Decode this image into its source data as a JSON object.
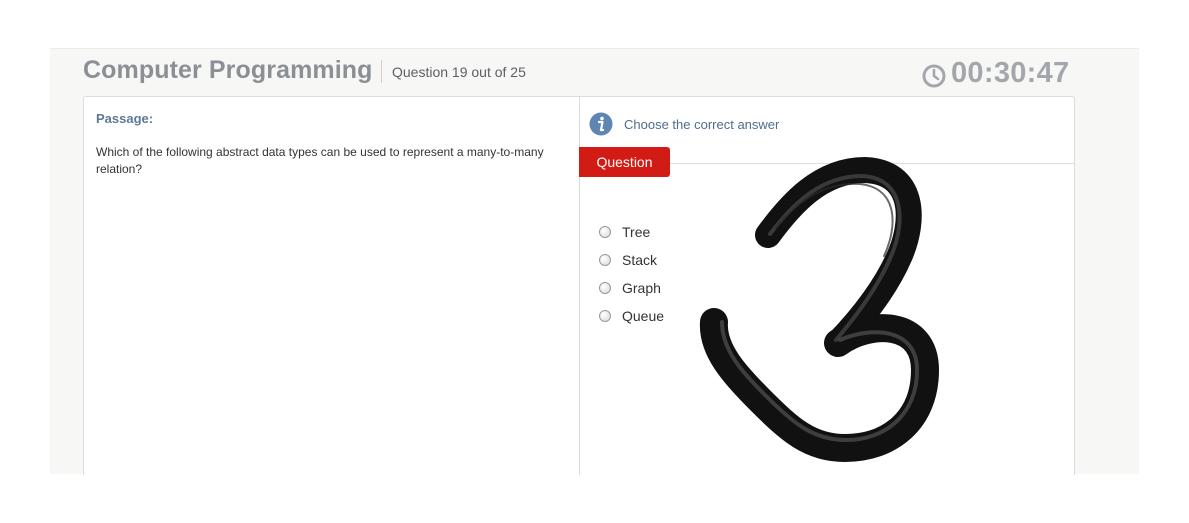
{
  "header": {
    "title": "Computer Programming",
    "question_counter": "Question 19 out of 25",
    "timer": "00:30:47",
    "timer_icon": "clock-icon"
  },
  "passage": {
    "label": "Passage:",
    "text": "Which of the following abstract data types can be used to represent a many-to-many relation?"
  },
  "question_panel": {
    "info_icon": "info-icon",
    "instruction": "Choose the correct answer",
    "tab_label": "Question",
    "options": [
      {
        "label": "Tree"
      },
      {
        "label": "Stack"
      },
      {
        "label": "Graph"
      },
      {
        "label": "Queue"
      }
    ]
  },
  "colors": {
    "tab_red": "#d21b14",
    "title_gray": "#8b8f96",
    "info_blue": "#5f86b3",
    "annotation_black": "#111111"
  },
  "annotation": {
    "type": "hand-drawn number overlay",
    "glyph_icon": "handwritten-3-icon"
  }
}
